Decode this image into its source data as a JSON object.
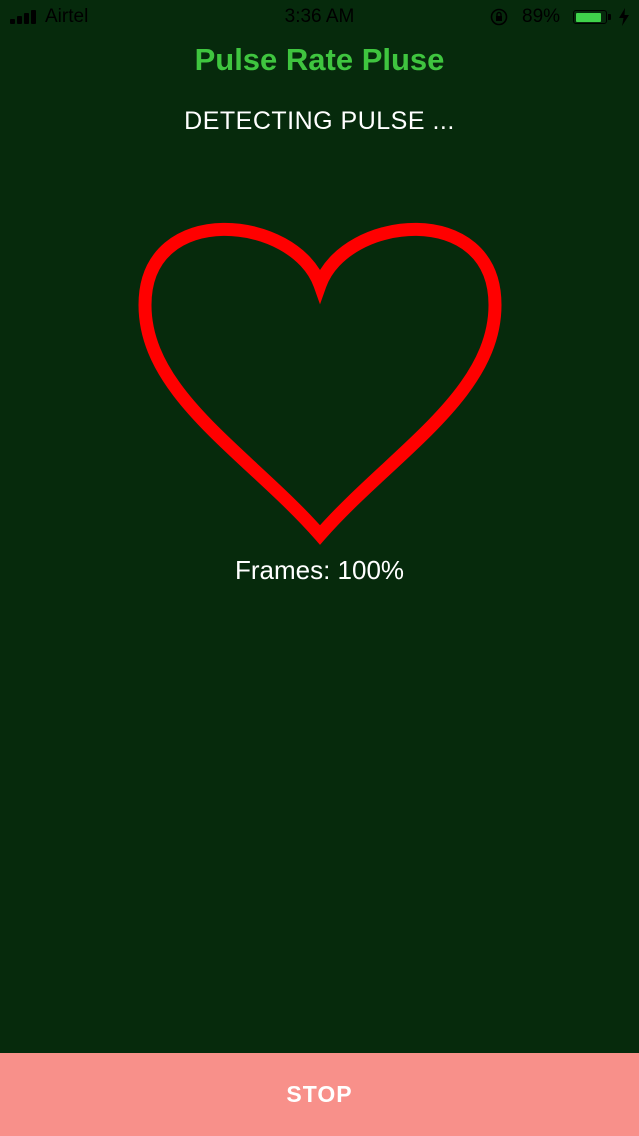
{
  "status_bar": {
    "carrier": "Airtel",
    "time": "3:36 AM",
    "battery_percent": "89%",
    "battery_level": 0.89,
    "battery_fill_color": "#3fd24b",
    "icons": [
      "signal-icon",
      "orientation-lock-icon",
      "battery-icon",
      "charging-icon"
    ]
  },
  "header": {
    "title": "Pulse Rate Pluse",
    "title_color": "#3fc53f"
  },
  "main": {
    "status_text": "DETECTING PULSE ...",
    "heart_icon": "heart-outline-icon",
    "heart_color": "#ff0000",
    "frames_label": "Frames: 100%"
  },
  "footer": {
    "stop_label": "STOP",
    "stop_color": "#f8908a"
  },
  "background_color": "#062a0c"
}
